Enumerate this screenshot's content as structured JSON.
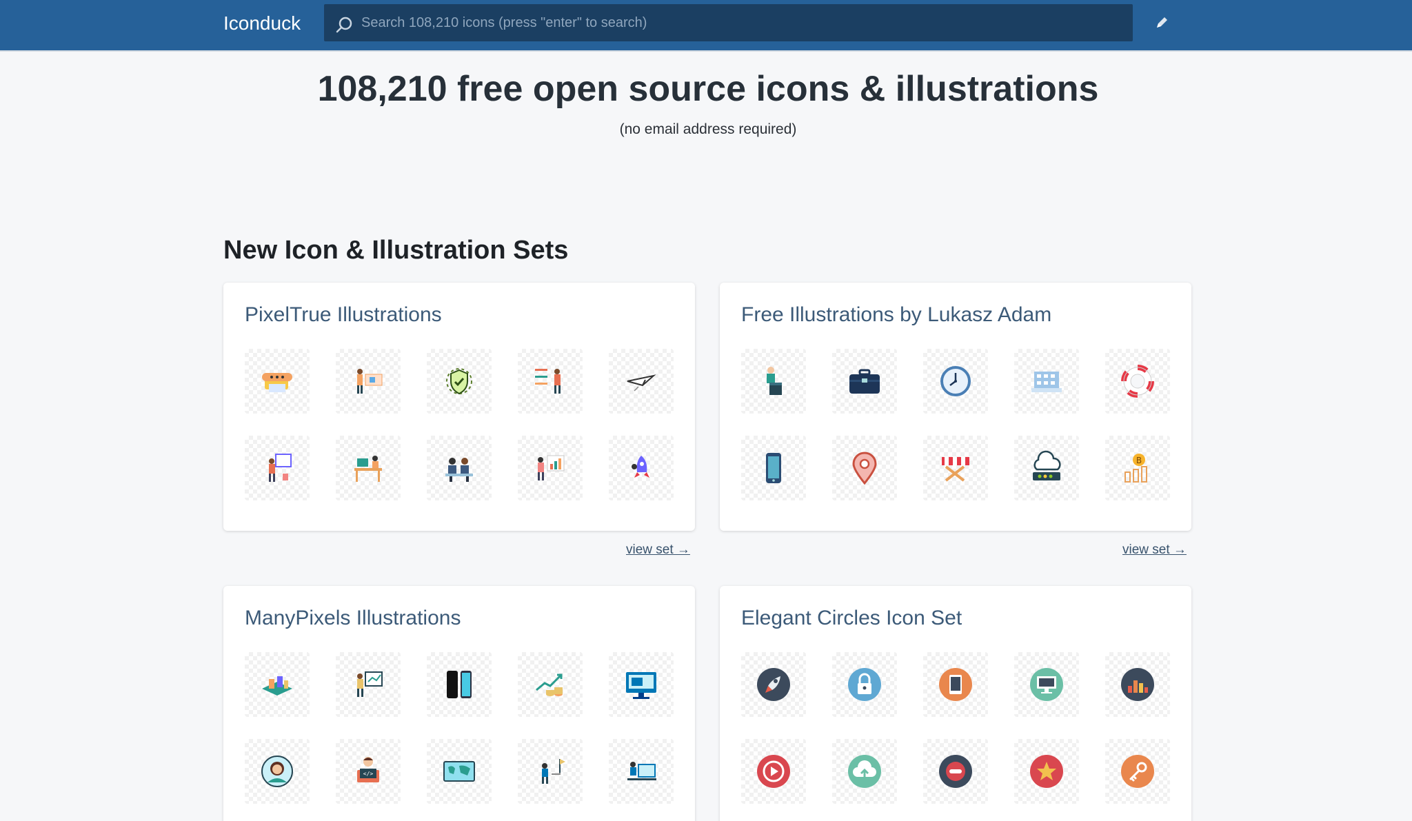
{
  "header": {
    "brand": "Iconduck",
    "search_placeholder": "Search 108,210 icons (press \"enter\" to search)"
  },
  "hero": {
    "title": "108,210 free open source icons & illustrations",
    "subtitle": "(no email address required)"
  },
  "section": {
    "title": "New Icon & Illustration Sets"
  },
  "sets": [
    {
      "title": "PixelTrue Illustrations",
      "view_label": "view set →",
      "icons": [
        "scroll-chat-illustration",
        "presentation-board-illustration",
        "shield-virus-illustration",
        "checklist-person-illustration",
        "paper-plane-illustration",
        "person-at-whiteboard-illustration",
        "desk-worker-illustration",
        "team-meeting-illustration",
        "person-with-chart-illustration",
        "rocket-person-illustration"
      ]
    },
    {
      "title": "Free Illustrations by Lukasz Adam",
      "view_label": "view set →",
      "icons": [
        "man-at-podium-illustration",
        "briefcase-illustration",
        "clock-illustration",
        "building-illustration",
        "lifebuoy-illustration",
        "smartphone-illustration",
        "map-pin-illustration",
        "barrier-illustration",
        "cloud-server-illustration",
        "bitcoin-chart-illustration"
      ]
    },
    {
      "title": "ManyPixels Illustrations",
      "view_label": "",
      "icons": [
        "isometric-city-illustration",
        "teacher-board-illustration",
        "smartphones-illustration",
        "growth-coins-illustration",
        "desktop-monitor-illustration",
        "woman-avatar-illustration",
        "developer-laptop-illustration",
        "world-map-illustration",
        "goal-flag-illustration",
        "office-worker-illustration"
      ]
    },
    {
      "title": "Elegant Circles Icon Set",
      "view_label": "",
      "icons": [
        "rocket-circle-icon",
        "lock-circle-icon",
        "tablet-circle-icon",
        "monitor-circle-icon",
        "equalizer-circle-icon",
        "play-circle-icon",
        "cloud-upload-circle-icon",
        "minus-circle-icon",
        "star-circle-icon",
        "key-circle-icon"
      ]
    }
  ]
}
